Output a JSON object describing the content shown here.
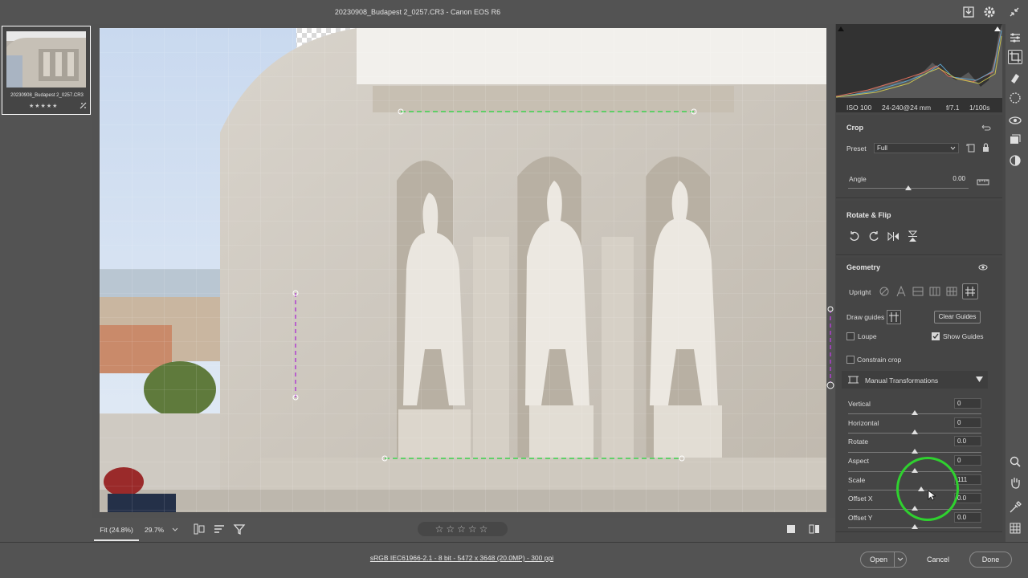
{
  "title": "20230908_Budapest 2_0257.CR3  -  Canon EOS R6",
  "filmstrip": {
    "filename": "20230908_Budapest 2_0257.CR3",
    "stars": "★★★★★"
  },
  "viewbar": {
    "zoom_fit": "Fit (24.8%)",
    "zoom_pct": "29.7%",
    "rating": "☆☆☆☆☆"
  },
  "status": {
    "file_info": "sRGB IEC61966-2.1 - 8 bit - 5472 x 3648 (20.0MP) - 300 ppi",
    "open_label": "Open",
    "cancel_label": "Cancel",
    "done_label": "Done"
  },
  "histogram": {
    "iso": "ISO 100",
    "lens": "24-240@24 mm",
    "aperture": "f/7.1",
    "shutter": "1/100s"
  },
  "crop": {
    "title": "Crop",
    "preset_label": "Preset",
    "preset_value": "Full",
    "angle_label": "Angle",
    "angle_value": "0.00"
  },
  "rotate": {
    "title": "Rotate & Flip"
  },
  "geometry": {
    "title": "Geometry",
    "upright_label": "Upright",
    "draw_guides_label": "Draw guides",
    "clear_guides_label": "Clear Guides",
    "loupe_label": "Loupe",
    "show_guides_label": "Show Guides",
    "constrain_label": "Constrain crop",
    "manual_label": "Manual Transformations",
    "sliders": [
      {
        "label": "Vertical",
        "value": "0",
        "level": 0.5
      },
      {
        "label": "Horizontal",
        "value": "0",
        "level": 0.5
      },
      {
        "label": "Rotate",
        "value": "0.0",
        "level": 0.5
      },
      {
        "label": "Aspect",
        "value": "0",
        "level": 0.5
      },
      {
        "label": "Scale",
        "value": "111",
        "level": 0.55
      },
      {
        "label": "Offset X",
        "value": "0.0",
        "level": 0.5
      },
      {
        "label": "Offset Y",
        "value": "0.0",
        "level": 0.5
      }
    ]
  },
  "colors": {
    "accent_green": "#2fd12f",
    "guide_green": "#3fd34f",
    "guide_purple": "#b040d0"
  }
}
